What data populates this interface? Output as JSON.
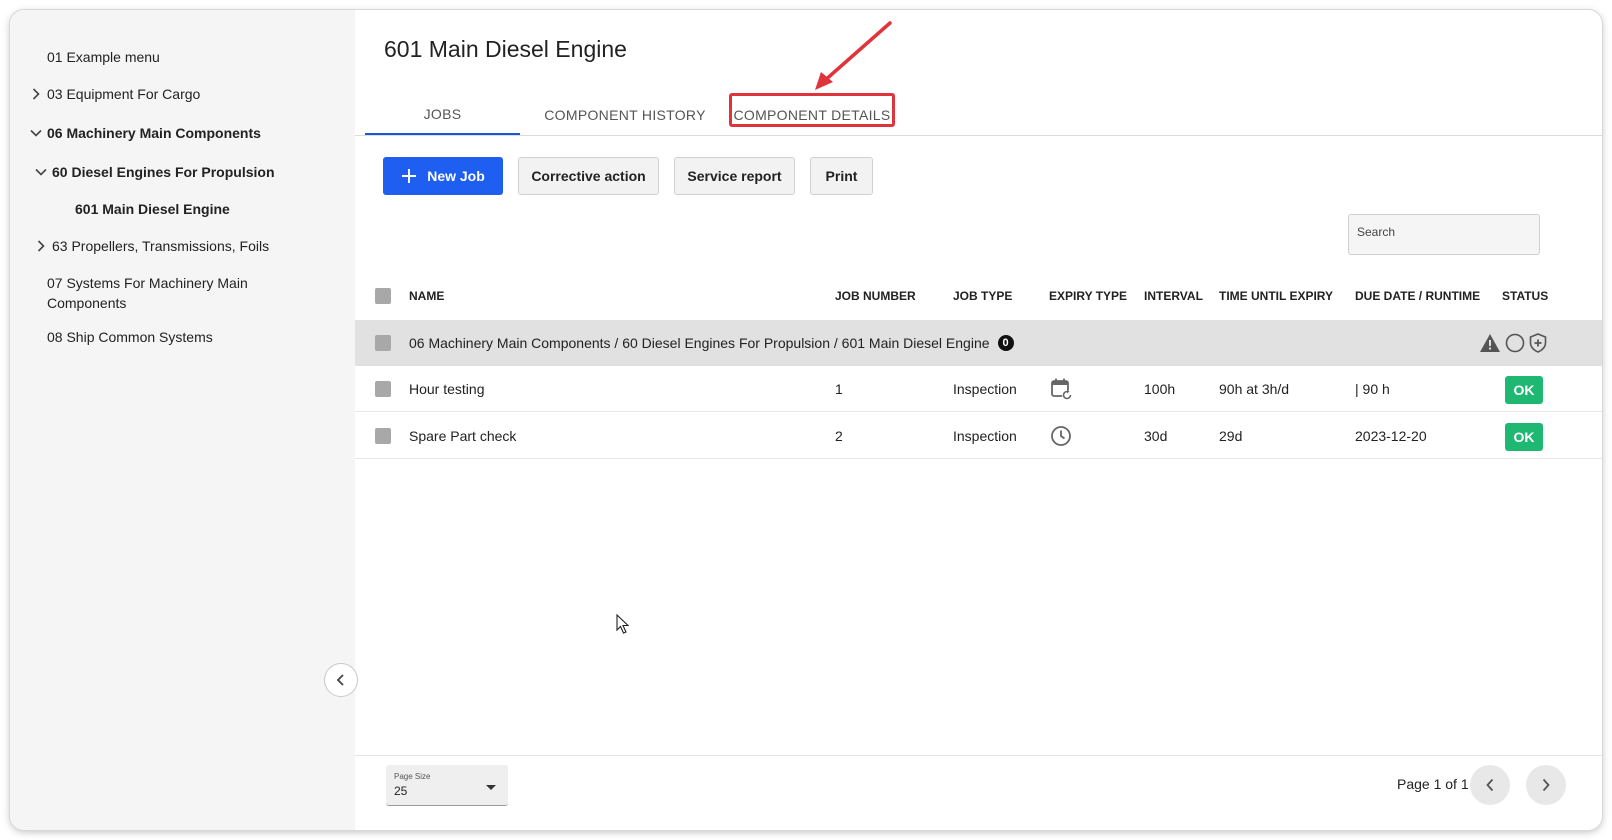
{
  "sidebar": {
    "items": [
      {
        "label": "01 Example menu",
        "expander": "none"
      },
      {
        "label": "03 Equipment For Cargo",
        "expander": "collapsed"
      },
      {
        "label": "06 Machinery Main Components",
        "expander": "expanded"
      },
      {
        "label": "60 Diesel Engines For Propulsion",
        "expander": "expanded"
      },
      {
        "label": "601 Main Diesel Engine",
        "expander": "none"
      },
      {
        "label": "63 Propellers, Transmissions, Foils",
        "expander": "collapsed"
      },
      {
        "label": "07 Systems For Machinery Main",
        "label2": "Components",
        "expander": "none"
      },
      {
        "label": "08 Ship Common Systems",
        "expander": "none"
      }
    ]
  },
  "page": {
    "title": "601 Main Diesel Engine"
  },
  "tabs": [
    {
      "label": "JOBS",
      "active": true
    },
    {
      "label": "COMPONENT HISTORY",
      "active": false
    },
    {
      "label": "COMPONENT DETAILS",
      "active": false,
      "highlighted": true
    }
  ],
  "toolbar": {
    "new_job": "New Job",
    "corrective_action": "Corrective action",
    "service_report": "Service report",
    "print": "Print"
  },
  "search": {
    "placeholder": "Search"
  },
  "table": {
    "columns": [
      "NAME",
      "JOB NUMBER",
      "JOB TYPE",
      "EXPIRY TYPE",
      "INTERVAL",
      "TIME UNTIL EXPIRY",
      "DUE DATE / RUNTIME",
      "STATUS"
    ],
    "group": {
      "path": "06 Machinery Main Components / 60 Diesel Engines For Propulsion / 601 Main Diesel Engine",
      "count": "0"
    },
    "rows": [
      {
        "name": "Hour testing",
        "job_number": "1",
        "job_type": "Inspection",
        "expiry_icon": "calendar-refresh-icon",
        "interval": "100h",
        "time_until_expiry": "90h at 3h/d",
        "due": "| 90 h",
        "status": "OK"
      },
      {
        "name": "Spare Part check",
        "job_number": "2",
        "job_type": "Inspection",
        "expiry_icon": "clock-icon",
        "interval": "30d",
        "time_until_expiry": "29d",
        "due": "2023-12-20",
        "status": "OK"
      }
    ]
  },
  "footer": {
    "page_size_label": "Page Size",
    "page_size_value": "25",
    "page_info": "Page 1 of 1"
  },
  "colors": {
    "primary": "#1e5ef0",
    "ok": "#1fb873",
    "highlight": "#e0343d"
  }
}
